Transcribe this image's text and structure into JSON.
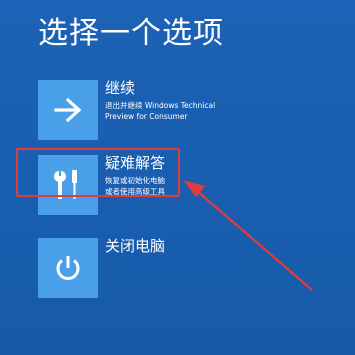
{
  "page": {
    "title": "选择一个选项"
  },
  "options": [
    {
      "title": "继续",
      "desc_lines": [
        "退出并继续 Windows Technical",
        "Preview for Consumer"
      ],
      "icon": "arrow-right-icon"
    },
    {
      "title": "疑难解答",
      "desc_lines": [
        "恢复或初始化电脑",
        "或者使用高级工具"
      ],
      "icon": "tools-icon"
    },
    {
      "title": "关闭电脑",
      "desc_lines": [],
      "icon": "power-icon"
    }
  ],
  "colors": {
    "background": "#1a5fb3",
    "tile": "#4aa0e8",
    "annotation": "#e23b3b"
  }
}
